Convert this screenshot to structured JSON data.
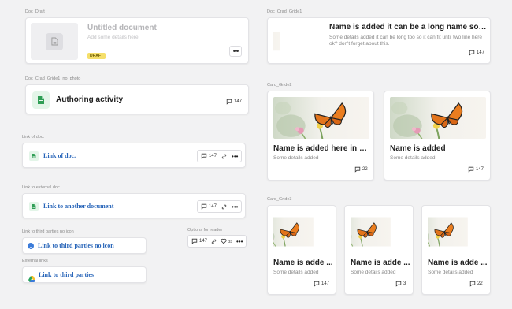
{
  "labels": {
    "doc_draft": "Doc_Draft",
    "doc_crad_grid1_no_photo": "Doc_Crad_Gride1_no_photo",
    "link_of_doc": "Link of doc.",
    "link_external": "Link to external doc",
    "link_third_no_icon": "Link to third parties no icon",
    "external_links": "External links",
    "options_for_reader": "Options for reader",
    "doc_crad_grid1": "Doc_Crad_Gride1",
    "card_grid2": "Card_Gride2",
    "card_grid3": "Card_Gride3"
  },
  "draft": {
    "title": "Untitled document",
    "details": "Add some details here",
    "badge": "DRAFT",
    "more": "•••"
  },
  "authoring": {
    "title": "Authoring activity",
    "comments": "147"
  },
  "link_doc": {
    "text": "Link of doc.",
    "comments": "147",
    "more": "•••"
  },
  "link_external": {
    "text": "Link to another document",
    "comments": "147",
    "more": "•••"
  },
  "link_third_no_icon": {
    "text": "Link to third parties no icon"
  },
  "external_link": {
    "text": "Link to third parties"
  },
  "reader_options": {
    "comments": "147",
    "likes": "33",
    "more": "•••"
  },
  "grid1": {
    "title": "Name is added it can be a long name so this...",
    "details": "Some details added it can be long too so it can fit until two line here ok? don't forget about this.",
    "comments": "147"
  },
  "grid2": [
    {
      "title": "Name is added here in one...",
      "details": "Some details added",
      "comments": "22"
    },
    {
      "title": "Name is added",
      "details": "Some details added",
      "comments": "147"
    }
  ],
  "grid3": [
    {
      "title": "Name is adde ...",
      "details": "Some details added",
      "comments": "147"
    },
    {
      "title": "Name is adde ...",
      "details": "Some details added",
      "comments": "3"
    },
    {
      "title": "Name is adde ...",
      "details": "Some details added",
      "comments": "22"
    }
  ],
  "colors": {
    "link": "#2563b8",
    "doc_icon_green": "#2f9e55",
    "doc_icon_bg": "#e3f5e8",
    "draft_badge": "#f5df6b"
  }
}
